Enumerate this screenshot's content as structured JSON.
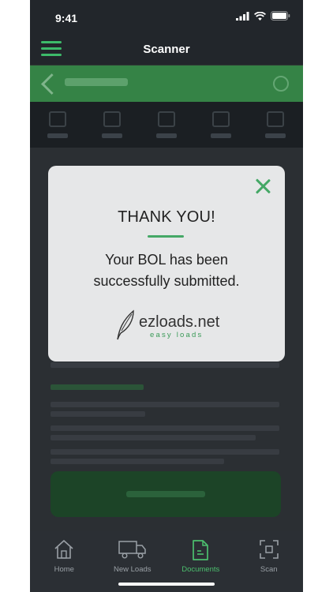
{
  "status_bar": {
    "time": "9:41"
  },
  "header": {
    "title": "Scanner"
  },
  "modal": {
    "title": "THANK YOU!",
    "message_line1": "Your BOL has been",
    "message_line2": "successfully submitted.",
    "brand_name": "ezloads.net",
    "brand_tagline": "easy loads"
  },
  "tabs": [
    {
      "label": "Home",
      "icon": "home-icon",
      "active": false
    },
    {
      "label": "New Loads",
      "icon": "truck-icon",
      "active": false
    },
    {
      "label": "Documents",
      "icon": "document-icon",
      "active": true
    },
    {
      "label": "Scan",
      "icon": "scan-icon",
      "active": false
    }
  ],
  "colors": {
    "accent": "#45a866",
    "background": "#22262b",
    "modal": "#e6e7e8"
  }
}
